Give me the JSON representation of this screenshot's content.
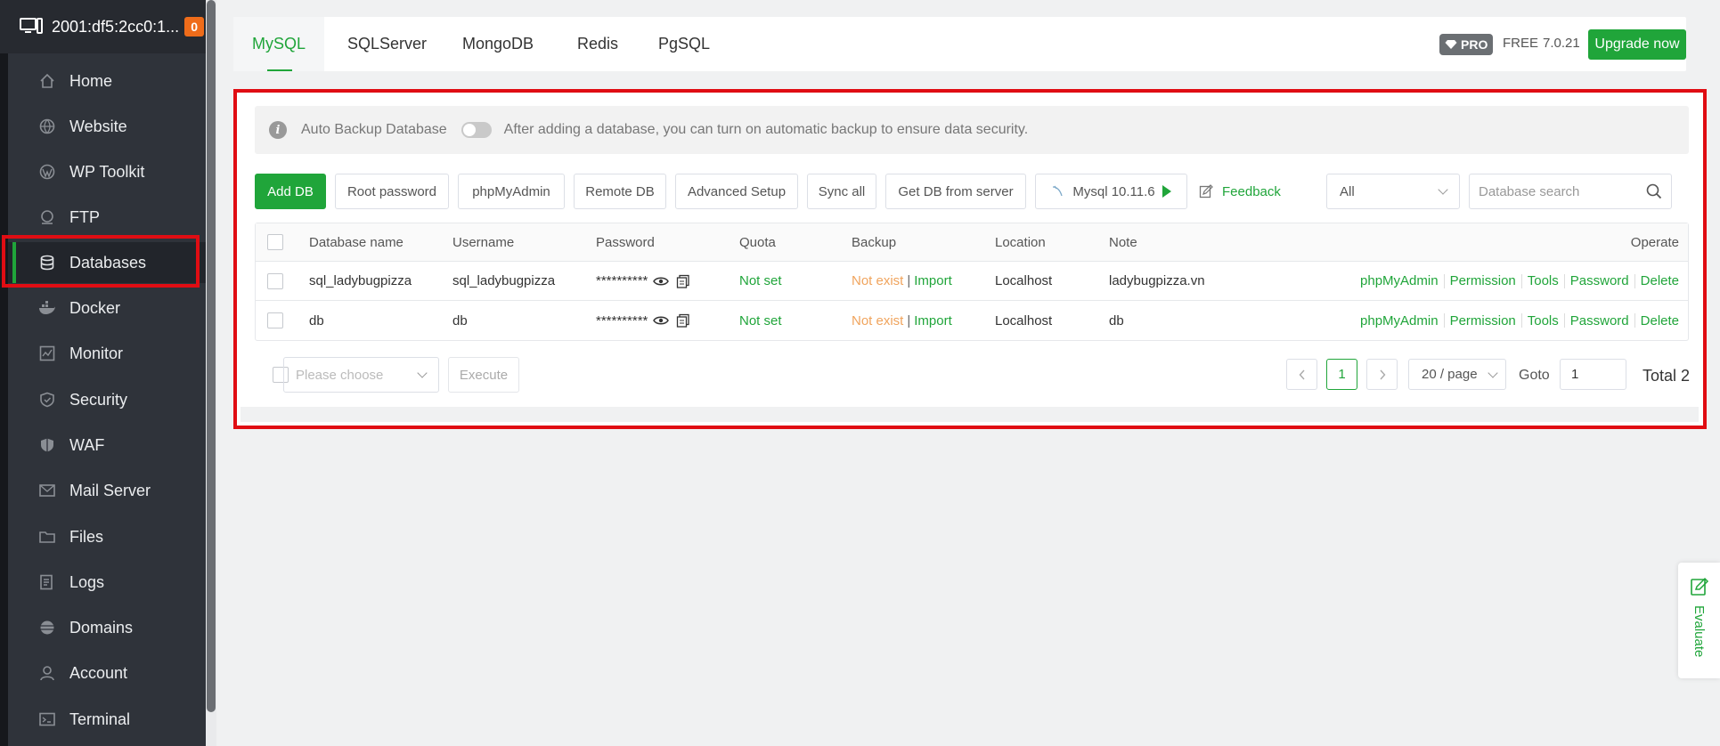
{
  "sidebar": {
    "server": {
      "address": "2001:df5:2cc0:1...",
      "badge": "0"
    },
    "items": [
      {
        "label": "Home",
        "icon": "home-icon"
      },
      {
        "label": "Website",
        "icon": "globe-icon"
      },
      {
        "label": "WP Toolkit",
        "icon": "wordpress-icon"
      },
      {
        "label": "FTP",
        "icon": "ftp-icon"
      },
      {
        "label": "Databases",
        "icon": "database-icon",
        "active": true
      },
      {
        "label": "Docker",
        "icon": "docker-icon"
      },
      {
        "label": "Monitor",
        "icon": "monitor-icon"
      },
      {
        "label": "Security",
        "icon": "shield-icon"
      },
      {
        "label": "WAF",
        "icon": "waf-shield-icon"
      },
      {
        "label": "Mail Server",
        "icon": "mail-icon"
      },
      {
        "label": "Files",
        "icon": "folder-icon"
      },
      {
        "label": "Logs",
        "icon": "logs-icon"
      },
      {
        "label": "Domains",
        "icon": "domains-icon"
      },
      {
        "label": "Account",
        "icon": "user-icon"
      },
      {
        "label": "Terminal",
        "icon": "terminal-icon"
      }
    ]
  },
  "header": {
    "tabs": [
      "MySQL",
      "SQLServer",
      "MongoDB",
      "Redis",
      "PgSQL"
    ],
    "active_tab": "MySQL",
    "pro_label": "PRO",
    "free_label": "FREE",
    "version": "7.0.21",
    "upgrade_label": "Upgrade now"
  },
  "notice": {
    "title": "Auto Backup Database",
    "message": "After adding a database, you can turn on automatic backup to ensure data security."
  },
  "toolbar": {
    "add_db": "Add DB",
    "root_password": "Root password",
    "phpmyadmin": "phpMyAdmin",
    "remote_db": "Remote DB",
    "advanced_setup": "Advanced Setup",
    "sync_all": "Sync all",
    "get_db_from_server": "Get DB from server",
    "mysql_version": "Mysql 10.11.6",
    "feedback": "Feedback",
    "filter_value": "All",
    "search_placeholder": "Database search"
  },
  "table": {
    "headers": {
      "name": "Database name",
      "username": "Username",
      "password": "Password",
      "quota": "Quota",
      "backup": "Backup",
      "location": "Location",
      "note": "Note",
      "operate": "Operate"
    },
    "rows": [
      {
        "name": "sql_ladybugpizza",
        "username": "sql_ladybugpizza",
        "password": "**********",
        "quota": "Not set",
        "backup": "Not exist",
        "import": "Import",
        "location": "Localhost",
        "note": "ladybugpizza.vn"
      },
      {
        "name": "db",
        "username": "db",
        "password": "**********",
        "quota": "Not set",
        "backup": "Not exist",
        "import": "Import",
        "location": "Localhost",
        "note": "db"
      }
    ],
    "operations": [
      "phpMyAdmin",
      "Permission",
      "Tools",
      "Password",
      "Delete"
    ]
  },
  "footer": {
    "batch_placeholder": "Please choose",
    "execute": "Execute",
    "current_page": "1",
    "page_size": "20 / page",
    "goto_label": "Goto",
    "goto_value": "1",
    "total": "Total 2"
  },
  "evaluate": {
    "label": "Evaluate"
  },
  "colors": {
    "accent": "#20a53a",
    "highlight": "#e00d13",
    "warning": "#f0a45d",
    "sidebar": "#2f333a"
  }
}
